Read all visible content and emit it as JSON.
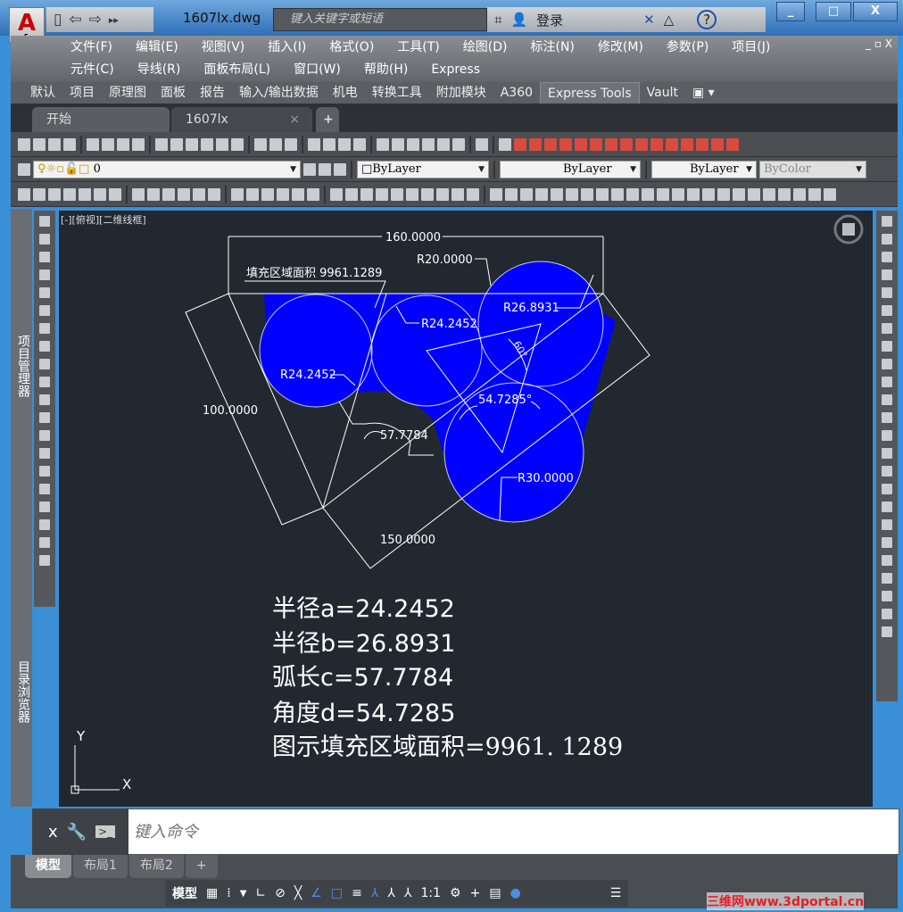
{
  "titlebar": {
    "app_menu_letter": "A",
    "app_menu_sub": "E",
    "doc_title": "1607lx.dwg",
    "search_placeholder": "键入关键字或短语",
    "login": "登录",
    "help": "?",
    "min": "_",
    "max": "□",
    "close": "X"
  },
  "menu": {
    "row1": [
      "文件(F)",
      "编辑(E)",
      "视图(V)",
      "插入(I)",
      "格式(O)",
      "工具(T)",
      "绘图(D)",
      "标注(N)",
      "修改(M)",
      "参数(P)",
      "项目(J)"
    ],
    "row2": [
      "元件(C)",
      "导线(R)",
      "面板布局(L)",
      "窗口(W)",
      "帮助(H)",
      "Express"
    ],
    "window_controls": "_ ▫ X"
  },
  "ribbon_tabs": [
    "默认",
    "项目",
    "原理图",
    "面板",
    "报告",
    "输入/输出数据",
    "机电",
    "转换工具",
    "附加模块",
    "A360",
    "Express Tools",
    "Vault"
  ],
  "ribbon_active": "Express Tools",
  "file_tabs": {
    "start": "开始",
    "current": "1607lx",
    "close": "×",
    "new": "+"
  },
  "properties": {
    "layer": "0",
    "color": "ByLayer",
    "linetype": "ByLayer",
    "lineweight": "ByLayer",
    "plotstyle": "ByColor"
  },
  "side_panels": {
    "project_manager": "项目管理器",
    "catalog_browser": "目录浏览器"
  },
  "viewport": {
    "label": "[-][俯视][二维线框]"
  },
  "drawing": {
    "hatch_color": "#0000ff",
    "dims": {
      "width": "160.0000",
      "height": "100.0000",
      "base": "150.0000",
      "r_top": "R20.0000",
      "r_mid": "R24.2452",
      "r_left": "R24.2452",
      "r_right": "R26.8931",
      "r_bottom": "R30.0000",
      "angle60": "60°",
      "angle_d": "54.7285°",
      "arc": "57.7784",
      "hatch_label": "填充区域面积 9961.1289"
    },
    "results": [
      "半径a=24.2452",
      "半径b=26.8931",
      "弧长c=57.7784",
      "角度d=54.7285",
      "图示填充区域面积=9961. 1289"
    ],
    "ucs": {
      "x": "X",
      "y": "Y"
    }
  },
  "command": {
    "close": "x",
    "placeholder": "键入命令"
  },
  "layout_tabs": [
    "模型",
    "布局1",
    "布局2",
    "+"
  ],
  "status": {
    "model": "模型",
    "scale": "1:1"
  },
  "watermark": "三维网www.3dportal.cn"
}
